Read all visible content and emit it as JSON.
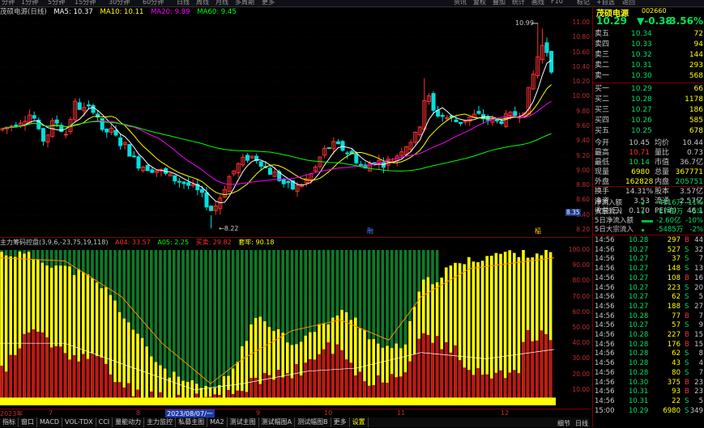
{
  "colors": {
    "up": "#ff3030",
    "down": "#00e0e0",
    "ma5": "#ffffff",
    "ma10": "#ffff00",
    "ma20": "#ff00ff",
    "ma60": "#00ff00",
    "yellow": "#ffff00",
    "red": "#c81414",
    "green": "#0f7a28"
  },
  "topbar": {
    "left_items": [
      "分钟",
      "1分钟",
      "5分钟",
      "15分钟",
      "30分钟",
      "60分钟",
      "日线",
      "周线",
      "月线",
      "多周期",
      "更多"
    ],
    "right_items": [
      "资讯",
      "复权",
      "叠加",
      "统计",
      "画线",
      "F10",
      "标记",
      "+自选",
      "返回"
    ]
  },
  "chart_header": {
    "name": "茂硕电源(日线)",
    "ma5": "MA5: 10.37",
    "ma10": "MA10: 10.11",
    "ma20": "MA20: 9.89",
    "ma60": "MA60: 9.45"
  },
  "price_axis": [
    "11.00",
    "10.80",
    "10.60",
    "10.40",
    "10.20",
    "10.00",
    "9.80",
    "9.60",
    "9.40",
    "9.20",
    "9.00",
    "8.80",
    "8.60",
    "8.40",
    "8.20"
  ],
  "price_axis_values": [
    11.0,
    10.8,
    10.6,
    10.4,
    10.2,
    10.0,
    9.8,
    9.6,
    9.4,
    9.2,
    9.0,
    8.8,
    8.6,
    8.4,
    8.2
  ],
  "current_price_tag": "8.35",
  "annotations": {
    "high": "10.99",
    "low": "8.22",
    "marker_a": "融",
    "marker_b": "榀"
  },
  "indicator_header": {
    "name": "主力筹码控盘(3,9,6,-23,75,19,118)",
    "a04": "A04: 33.57",
    "a05": "A05: 2.25",
    "jsc": "买卖: 29.82",
    "zsc": "套牢: 90.18"
  },
  "indicator_axis": [
    "100.00",
    "90.00",
    "80.00",
    "70.00",
    "60.00",
    "50.00",
    "40.00",
    "30.00",
    "20.00",
    "10.00"
  ],
  "date_axis": {
    "labels": [
      "2023年",
      "7",
      "8",
      "2023/08/07/一",
      "9",
      "10",
      "11",
      "12"
    ]
  },
  "bottom_tabs": [
    "指标",
    "窗口",
    "MACD",
    "VOL-TDX",
    "CCI",
    "量能动力",
    "主力监控",
    "私募主图",
    "MA2",
    "测试主图",
    "测试幅图A",
    "测试幅图B",
    "更多",
    "设置"
  ],
  "quote": {
    "name": "茂硕电源",
    "code": "002660",
    "price": "10.29",
    "change": "▼-0.38",
    "pct": "-3.56%",
    "asks": [
      {
        "label": "卖五",
        "price": "10.34",
        "vol": "72"
      },
      {
        "label": "卖四",
        "price": "10.33",
        "vol": "94"
      },
      {
        "label": "卖三",
        "price": "10.32",
        "vol": "144"
      },
      {
        "label": "卖二",
        "price": "10.31",
        "vol": "293"
      },
      {
        "label": "卖一",
        "price": "10.30",
        "vol": "568"
      }
    ],
    "bids": [
      {
        "label": "买一",
        "price": "10.29",
        "vol": "66"
      },
      {
        "label": "买二",
        "price": "10.28",
        "vol": "1178"
      },
      {
        "label": "买三",
        "price": "10.27",
        "vol": "186"
      },
      {
        "label": "买四",
        "price": "10.26",
        "vol": "585"
      },
      {
        "label": "买五",
        "price": "10.25",
        "vol": "678"
      }
    ],
    "stats": [
      {
        "k1": "今开",
        "v1": "10.45",
        "k2": "均价",
        "v2": "10.44"
      },
      {
        "k1": "最高",
        "v1": "10.71",
        "k2": "量比",
        "v2": "0.73"
      },
      {
        "k1": "最低",
        "v1": "10.14",
        "k2": "市值",
        "v2": "36.7亿"
      },
      {
        "k1": "现量",
        "v1": "6980",
        "k2": "总量",
        "v2": "367771"
      },
      {
        "k1": "外盘",
        "v1": "162828",
        "k2": "内盘",
        "v2": "205751"
      },
      {
        "k1": "换手",
        "v1": "14.31%",
        "k2": "股本",
        "v2": "3.57亿"
      },
      {
        "k1": "净资",
        "v1": "3.53",
        "k2": "流通",
        "v2": "2.57亿"
      },
      {
        "k1": "收益(三)",
        "v1": "0.170",
        "k2": "PE(动)",
        "v2": "46.1"
      }
    ],
    "flows": [
      {
        "label": "净流入额",
        "value": "-4116万",
        "pct": "-11%"
      },
      {
        "label": "大宗流入",
        "value": "-1749万",
        "pct": "-5%"
      },
      {
        "label": "5日净流入额",
        "value": "-2.60亿",
        "pct": "-10%"
      },
      {
        "label": "5日大宗流入",
        "value": "-5485万",
        "pct": "-2%"
      }
    ],
    "ticks": [
      {
        "t": "14:56",
        "p": "10.28",
        "v": "297",
        "d": "B",
        "n": "44"
      },
      {
        "t": "14:56",
        "p": "10.27",
        "v": "527",
        "d": "S",
        "n": "32"
      },
      {
        "t": "14:56",
        "p": "10.27",
        "v": "37",
        "d": "S",
        "n": "7"
      },
      {
        "t": "14:56",
        "p": "10.27",
        "v": "148",
        "d": "S",
        "n": "13"
      },
      {
        "t": "14:56",
        "p": "10.27",
        "v": "108",
        "d": "B",
        "n": "16"
      },
      {
        "t": "14:56",
        "p": "10.27",
        "v": "223",
        "d": "S",
        "n": "20"
      },
      {
        "t": "14:56",
        "p": "10.27",
        "v": "62",
        "d": "S",
        "n": "5"
      },
      {
        "t": "14:56",
        "p": "10.27",
        "v": "188",
        "d": "S",
        "n": "27"
      },
      {
        "t": "14:56",
        "p": "10.28",
        "v": "77",
        "d": "B",
        "n": "7"
      },
      {
        "t": "14:56",
        "p": "10.27",
        "v": "57",
        "d": "S",
        "n": "9"
      },
      {
        "t": "14:56",
        "p": "10.28",
        "v": "227",
        "d": "B",
        "n": "15"
      },
      {
        "t": "14:56",
        "p": "10.28",
        "v": "176",
        "d": "B",
        "n": "15"
      },
      {
        "t": "14:56",
        "p": "10.28",
        "v": "62",
        "d": "S",
        "n": "8"
      },
      {
        "t": "14:56",
        "p": "10.28",
        "v": "43",
        "d": "S",
        "n": "4"
      },
      {
        "t": "14:56",
        "p": "10.28",
        "v": "80",
        "d": "S",
        "n": "7"
      },
      {
        "t": "14:56",
        "p": "10.30",
        "v": "375",
        "d": "B",
        "n": "23"
      },
      {
        "t": "14:56",
        "p": "10.31",
        "v": "93",
        "d": "B",
        "n": "23"
      },
      {
        "t": "14:56",
        "p": "10.31",
        "v": "22",
        "d": "S",
        "n": "5"
      },
      {
        "t": "15:00",
        "p": "10.29",
        "v": "6980",
        "d": "S",
        "n": "349"
      }
    ],
    "side_tabs": {
      "left": "细节",
      "right": "日线"
    }
  }
}
